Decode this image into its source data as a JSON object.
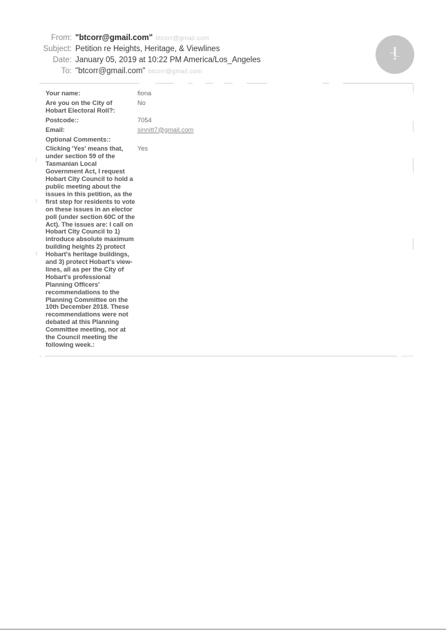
{
  "email": {
    "from_label": "From:",
    "from_value": "\"btcorr@gmail.com\"",
    "from_faded": "btcorr@gmail.com",
    "subject_label": "Subject:",
    "subject_value": "Petition re Heights, Heritage, & Viewlines",
    "date_label": "Date:",
    "date_value": "January 05, 2019 at 10:22 PM America/Los_Angeles",
    "to_label": "To:",
    "to_value": "\"btcorr@gmail.com\"",
    "to_faded": "btcorr@gmail.com"
  },
  "avatar": {
    "icon": "person-silhouette-icon",
    "color": "#c6c6c6"
  },
  "form": {
    "rows": [
      {
        "label": "Your name:",
        "value": "fiona"
      },
      {
        "label": "Are you on the City of Hobart Electoral Roll?:",
        "value": "No"
      },
      {
        "label": "Postcode::",
        "value": "7054"
      },
      {
        "label": "Email:",
        "value": "sinnitt7@gmail.com"
      },
      {
        "label": "Optional Comments::",
        "value": ""
      },
      {
        "label": "Clicking 'Yes' means that, under section 59 of the Tasmanian Local Government Act, I request Hobart City Council to hold a public meeting about the issues in this petition, as the first step for residents to vote on these issues in an elector poll (under section 60C of the Act). The issues are: I call on Hobart City Council to 1) introduce absolute maximum building heights 2) protect Hobart's heritage buildings, and 3) protect Hobart's view-lines, all as per the City of Hobart's professional Planning Officers' recommendations to the Planning Committee on the 10th December 2018. These recommendations were not debated at this Planning Committee meeting, nor at the Council meeting the following week.:",
        "value": "Yes"
      }
    ]
  }
}
